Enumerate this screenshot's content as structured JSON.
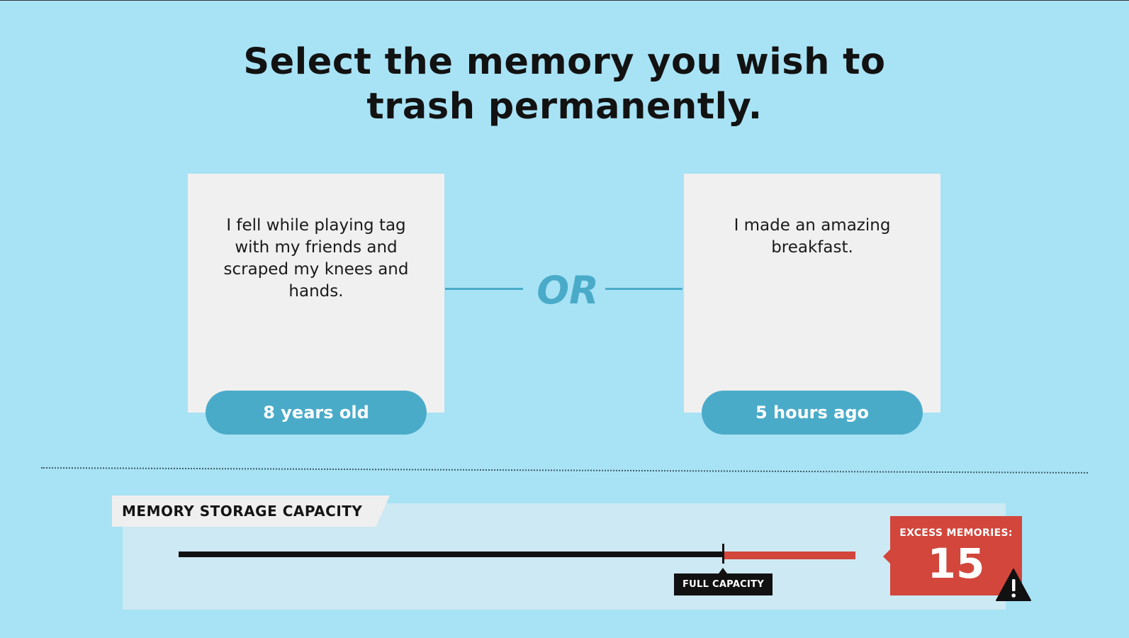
{
  "title": {
    "line1": "Select the memory you wish to",
    "line2": "trash permanently."
  },
  "choices": [
    {
      "text": "I fell while playing tag with my friends and scraped my knees and hands.",
      "age_label": "8 years old"
    },
    {
      "text": "I made an amazing breakfast.",
      "age_label": "5 hours ago"
    }
  ],
  "separator_label": "OR",
  "storage": {
    "label": "MEMORY STORAGE CAPACITY",
    "full_capacity_label": "FULL CAPACITY",
    "excess_label": "EXCESS MEMORIES:",
    "excess_count": "15",
    "warning_icon": "warning-icon"
  },
  "colors": {
    "background": "#a8e2f5",
    "accent": "#4aabc9",
    "card": "#f0f0f0",
    "over_capacity": "#d2463c"
  }
}
